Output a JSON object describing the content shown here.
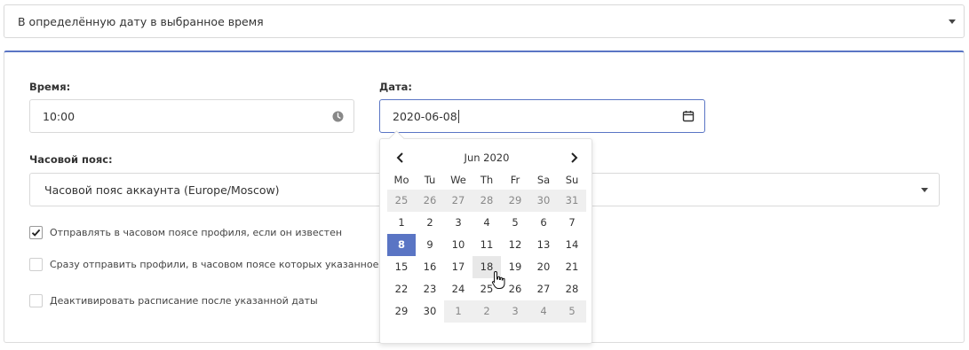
{
  "schedule_mode": {
    "value": "В определённую дату в выбранное время"
  },
  "time": {
    "label": "Время:",
    "value": "10:00"
  },
  "date": {
    "label": "Дата:",
    "value": "2020-06-08"
  },
  "timezone": {
    "label": "Часовой пояс:",
    "value": "Часовой пояс аккаунта (Europe/Moscow)"
  },
  "options": [
    {
      "label": "Отправлять в часовом поясе профиля, если он известен",
      "checked": true
    },
    {
      "label": "Сразу отправить профили, в часовом поясе которых указанное время",
      "checked": false
    },
    {
      "label": "Деактивировать расписание после указанной даты",
      "checked": false
    }
  ],
  "calendar": {
    "title": "Jun 2020",
    "weekdays": [
      "Mo",
      "Tu",
      "We",
      "Th",
      "Fr",
      "Sa",
      "Su"
    ],
    "weeks": [
      [
        {
          "d": "25",
          "o": true
        },
        {
          "d": "26",
          "o": true
        },
        {
          "d": "27",
          "o": true
        },
        {
          "d": "28",
          "o": true
        },
        {
          "d": "29",
          "o": true
        },
        {
          "d": "30",
          "o": true
        },
        {
          "d": "31",
          "o": true
        }
      ],
      [
        {
          "d": "1"
        },
        {
          "d": "2"
        },
        {
          "d": "3"
        },
        {
          "d": "4"
        },
        {
          "d": "5"
        },
        {
          "d": "6"
        },
        {
          "d": "7"
        }
      ],
      [
        {
          "d": "8",
          "sel": true
        },
        {
          "d": "9"
        },
        {
          "d": "10"
        },
        {
          "d": "11"
        },
        {
          "d": "12"
        },
        {
          "d": "13"
        },
        {
          "d": "14"
        }
      ],
      [
        {
          "d": "15"
        },
        {
          "d": "16"
        },
        {
          "d": "17"
        },
        {
          "d": "18",
          "hover": true
        },
        {
          "d": "19"
        },
        {
          "d": "20"
        },
        {
          "d": "21"
        }
      ],
      [
        {
          "d": "22"
        },
        {
          "d": "23"
        },
        {
          "d": "24"
        },
        {
          "d": "25"
        },
        {
          "d": "26"
        },
        {
          "d": "27"
        },
        {
          "d": "28"
        }
      ],
      [
        {
          "d": "29"
        },
        {
          "d": "30"
        },
        {
          "d": "1",
          "o": true
        },
        {
          "d": "2",
          "o": true
        },
        {
          "d": "3",
          "o": true
        },
        {
          "d": "4",
          "o": true
        },
        {
          "d": "5",
          "o": true
        }
      ]
    ]
  },
  "colors": {
    "accent": "#5a75c4",
    "other_month_bg": "#efefef",
    "hover_bg": "#e8e8e8"
  },
  "icons": {
    "time": "clock-icon",
    "date": "calendar-icon",
    "prev": "chevron-left-icon",
    "next": "chevron-right-icon",
    "cursor": "hand-pointer-icon"
  }
}
